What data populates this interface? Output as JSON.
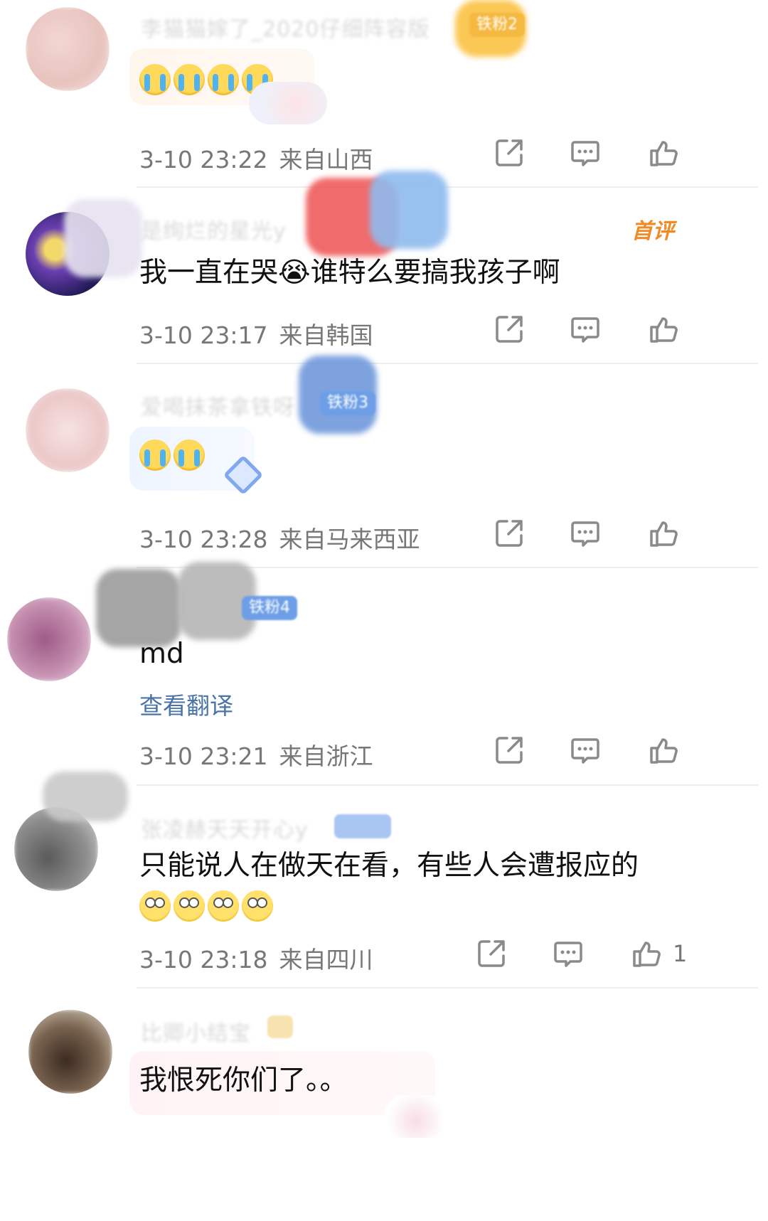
{
  "comments": [
    {
      "id": "c1",
      "username": "李猫猫嫁了_2020仔细阵容版",
      "badge": "铁粉2",
      "text": "",
      "emoji": [
        "cry",
        "cry",
        "cry",
        "cry"
      ],
      "time": "3-10 23:22",
      "location": "来自山西",
      "likes": ""
    },
    {
      "id": "c2",
      "username": "是绚烂的星光y",
      "first_tag": "首评",
      "text": "我一直在哭😭谁特么要搞我孩子啊",
      "time": "3-10 23:17",
      "location": "来自韩国",
      "likes": ""
    },
    {
      "id": "c3",
      "username": "爱喝抹茶拿铁呀",
      "badge": "铁粉3",
      "emoji": [
        "cry",
        "cry"
      ],
      "time": "3-10 23:28",
      "location": "来自马来西亚",
      "likes": ""
    },
    {
      "id": "c4",
      "username": "",
      "badge": "铁粉4",
      "text": "md",
      "translate": "查看翻译",
      "time": "3-10 23:21",
      "location": "来自浙江",
      "likes": ""
    },
    {
      "id": "c5",
      "username": "张凌赫天天开心y",
      "text": "只能说人在做天在看，有些人会遭报应的",
      "emoji": [
        "roll",
        "roll",
        "roll",
        "roll"
      ],
      "time": "3-10 23:18",
      "location": "来自四川",
      "likes": "1"
    },
    {
      "id": "c6",
      "username": "比卿小结宝",
      "text": "我恨死你们了。。",
      "time": "",
      "location": "",
      "likes": ""
    }
  ],
  "icons": {
    "share": "share-icon",
    "comment": "comment-icon",
    "like": "thumbs-up-icon"
  },
  "colors": {
    "meta": "#777777",
    "link": "#4a74a8",
    "first_tag": "#f08a24"
  }
}
